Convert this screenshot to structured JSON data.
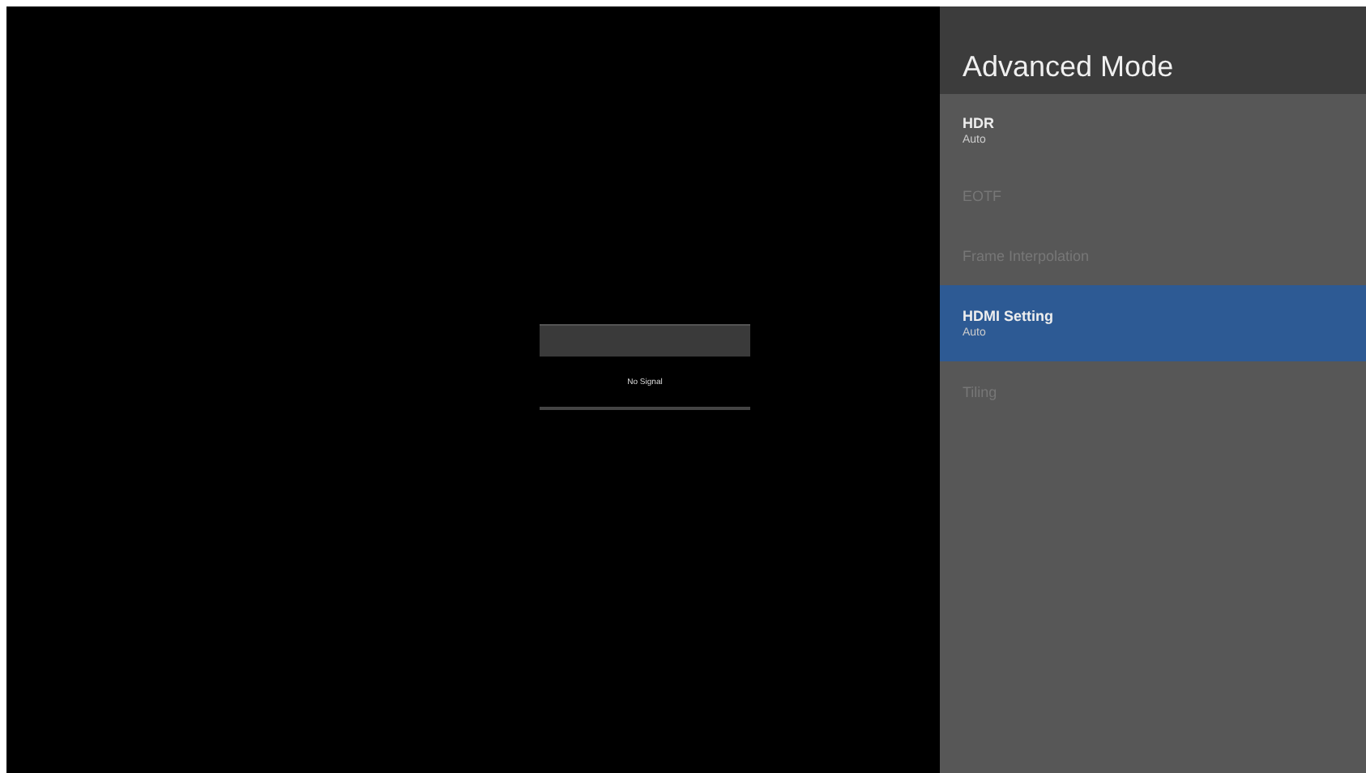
{
  "signal_dialog": {
    "message": "No Signal"
  },
  "panel": {
    "title": "Advanced Mode",
    "items": [
      {
        "label": "HDR",
        "value": "Auto",
        "disabled": false,
        "selected": false
      },
      {
        "label": "EOTF",
        "disabled": true,
        "selected": false
      },
      {
        "label": "Frame Interpolation",
        "disabled": true,
        "selected": false
      },
      {
        "label": "HDMI Setting",
        "value": "Auto",
        "disabled": false,
        "selected": true
      },
      {
        "label": "Tiling",
        "disabled": true,
        "selected": false
      }
    ]
  }
}
